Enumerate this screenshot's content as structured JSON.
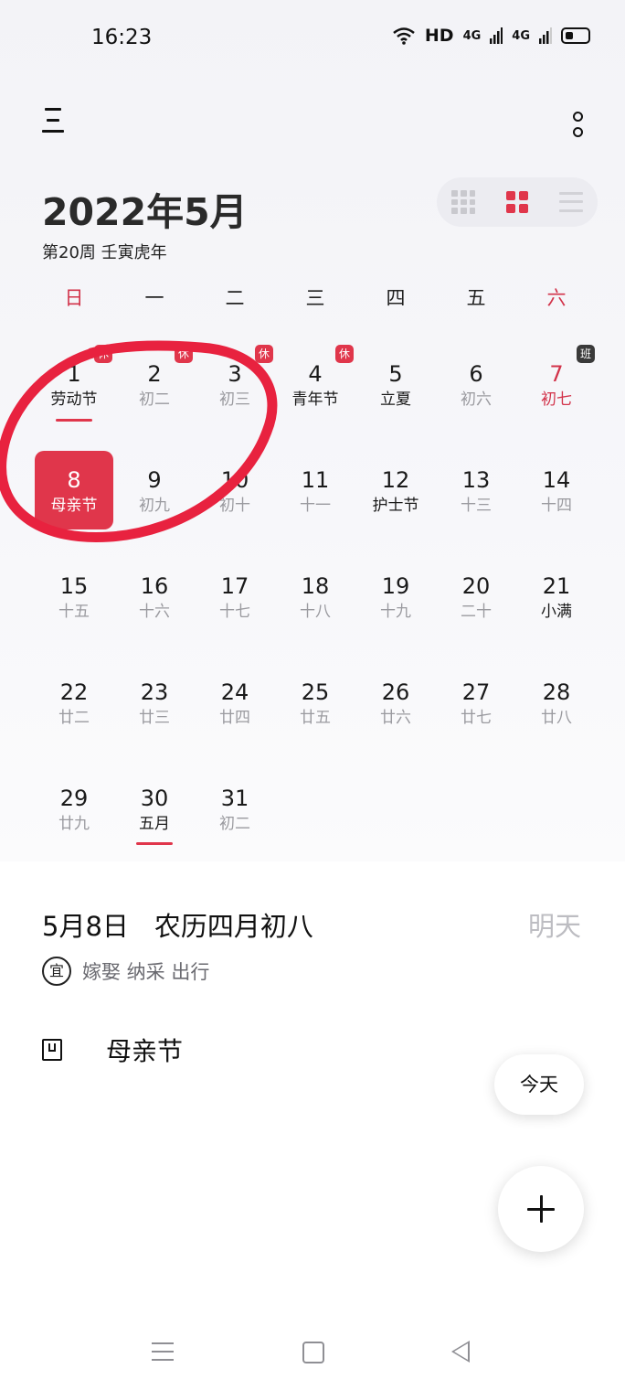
{
  "status_bar": {
    "time": "16:23",
    "hd": "HD",
    "net1": "4G",
    "net2": "4G"
  },
  "header": {
    "title": "2022年5月",
    "subtitle": "第20周 壬寅虎年"
  },
  "weekdays": [
    "日",
    "一",
    "二",
    "三",
    "四",
    "五",
    "六"
  ],
  "days": [
    {
      "num": "1",
      "sub": "劳动节",
      "badge": "休"
    },
    {
      "num": "2",
      "sub": "初二",
      "badge": "休"
    },
    {
      "num": "3",
      "sub": "初三",
      "badge": "休"
    },
    {
      "num": "4",
      "sub": "青年节",
      "badge": "休"
    },
    {
      "num": "5",
      "sub": "立夏"
    },
    {
      "num": "6",
      "sub": "初六"
    },
    {
      "num": "7",
      "sub": "初七",
      "badge": "班"
    },
    {
      "num": "8",
      "sub": "母亲节"
    },
    {
      "num": "9",
      "sub": "初九"
    },
    {
      "num": "10",
      "sub": "初十"
    },
    {
      "num": "11",
      "sub": "十一"
    },
    {
      "num": "12",
      "sub": "护士节"
    },
    {
      "num": "13",
      "sub": "十三"
    },
    {
      "num": "14",
      "sub": "十四"
    },
    {
      "num": "15",
      "sub": "十五"
    },
    {
      "num": "16",
      "sub": "十六"
    },
    {
      "num": "17",
      "sub": "十七"
    },
    {
      "num": "18",
      "sub": "十八"
    },
    {
      "num": "19",
      "sub": "十九"
    },
    {
      "num": "20",
      "sub": "二十"
    },
    {
      "num": "21",
      "sub": "小满"
    },
    {
      "num": "22",
      "sub": "廿二"
    },
    {
      "num": "23",
      "sub": "廿三"
    },
    {
      "num": "24",
      "sub": "廿四"
    },
    {
      "num": "25",
      "sub": "廿五"
    },
    {
      "num": "26",
      "sub": "廿六"
    },
    {
      "num": "27",
      "sub": "廿七"
    },
    {
      "num": "28",
      "sub": "廿八"
    },
    {
      "num": "29",
      "sub": "廿九"
    },
    {
      "num": "30",
      "sub": "五月"
    },
    {
      "num": "31",
      "sub": "初二"
    }
  ],
  "selected": {
    "date": "5月8日",
    "lunar": "农历四月初八",
    "relative": "明天",
    "yi_label": "宜",
    "yi_items": "嫁娶 纳采 出行"
  },
  "event": {
    "title": "母亲节"
  },
  "fab": {
    "today_label": "今天"
  },
  "colors": {
    "accent": "#e0364b",
    "weekend": "#d2334a",
    "muted": "#9a9a9f",
    "annotation_circle": "#e8223f"
  }
}
